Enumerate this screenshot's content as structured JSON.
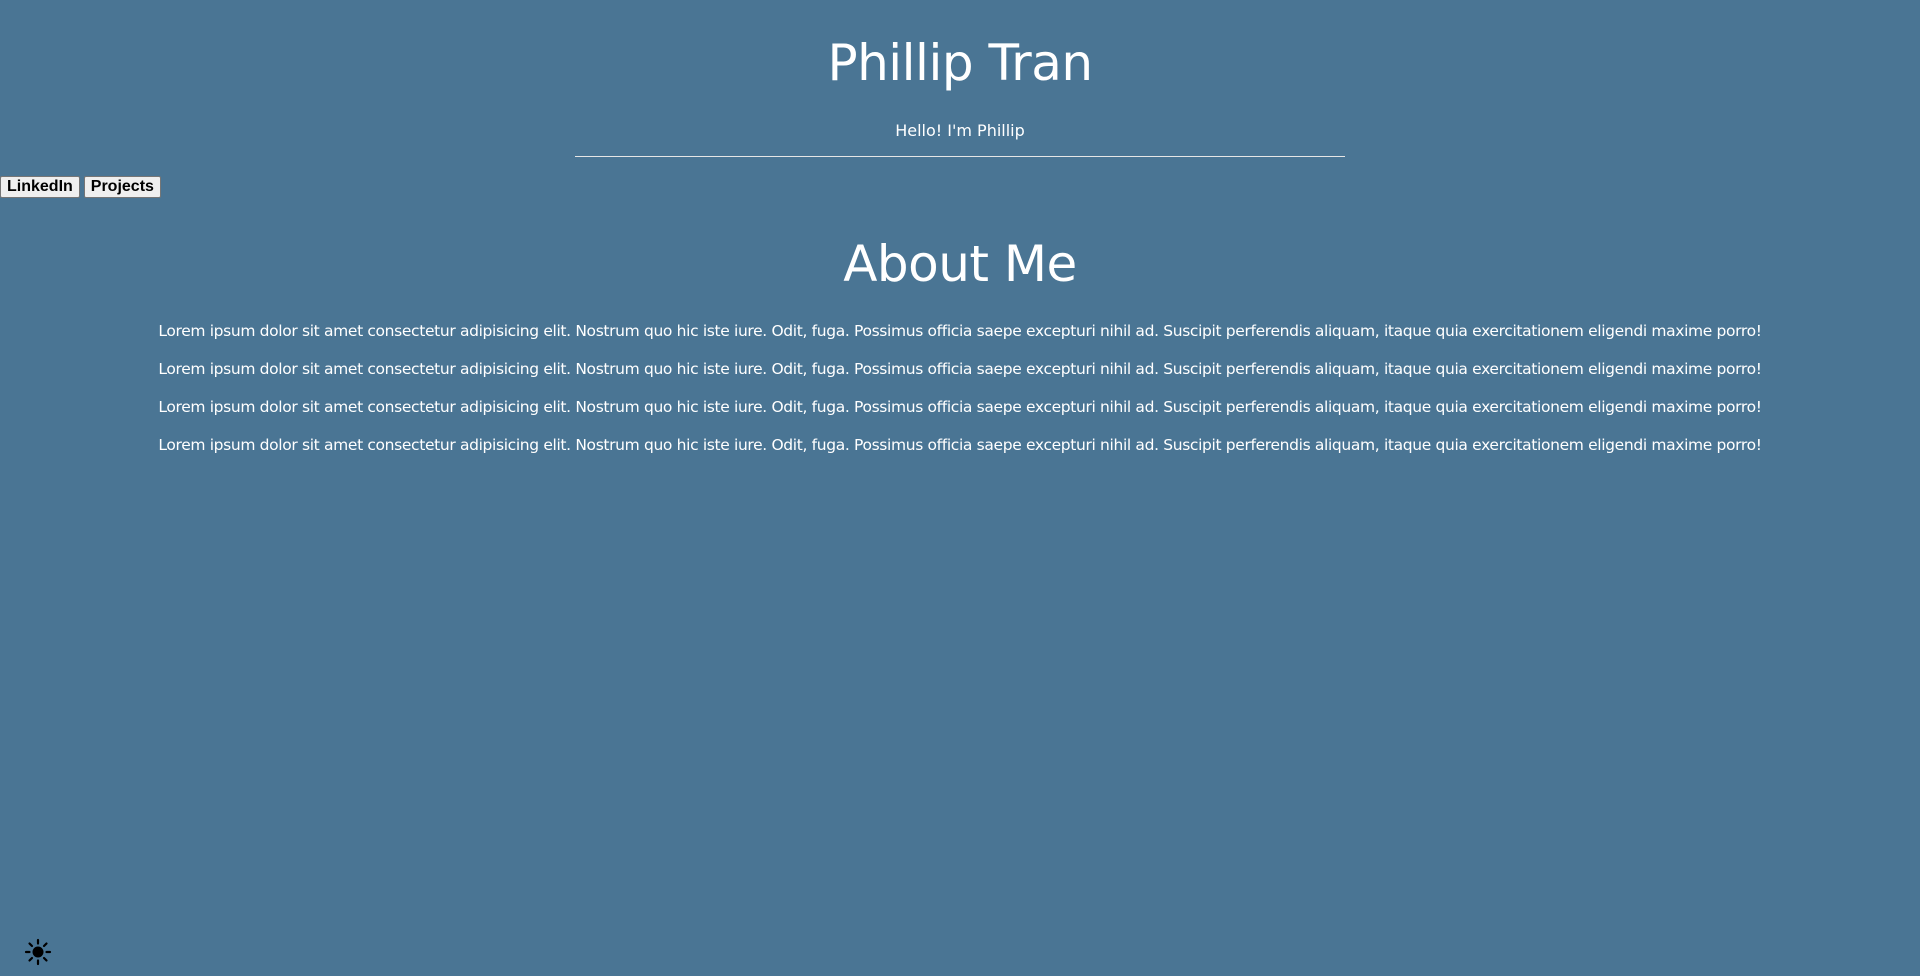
{
  "header": {
    "title": "Phillip Tran",
    "tagline": "Hello! I'm Phillip"
  },
  "nav": {
    "linkedin_label": "LinkedIn",
    "projects_label": "Projects"
  },
  "about": {
    "title": "About Me",
    "paragraphs": [
      "Lorem ipsum dolor sit amet consectetur adipisicing elit. Nostrum quo hic iste iure. Odit, fuga. Possimus officia saepe excepturi nihil ad. Suscipit perferendis aliquam, itaque quia exercitationem eligendi maxime porro!",
      "Lorem ipsum dolor sit amet consectetur adipisicing elit. Nostrum quo hic iste iure. Odit, fuga. Possimus officia saepe excepturi nihil ad. Suscipit perferendis aliquam, itaque quia exercitationem eligendi maxime porro!",
      "Lorem ipsum dolor sit amet consectetur adipisicing elit. Nostrum quo hic iste iure. Odit, fuga. Possimus officia saepe excepturi nihil ad. Suscipit perferendis aliquam, itaque quia exercitationem eligendi maxime porro!",
      "Lorem ipsum dolor sit amet consectetur adipisicing elit. Nostrum quo hic iste iure. Odit, fuga. Possimus officia saepe excepturi nihil ad. Suscipit perferendis aliquam, itaque quia exercitationem eligendi maxime porro!"
    ]
  },
  "theme_toggle": {
    "icon": "sun-icon"
  },
  "colors": {
    "background": "#4a7594",
    "text": "#ffffff",
    "divider": "#e6e6e6"
  }
}
